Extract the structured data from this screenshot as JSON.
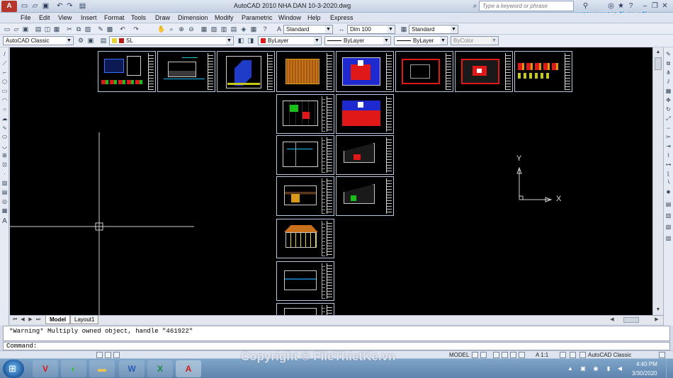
{
  "window": {
    "title": "AutoCAD 2010     NHA DAN 10-3-2020.dwg",
    "search_placeholder": "Type a keyword or phrase",
    "watermark_logo": "File Thiết Kế.vn"
  },
  "menu": [
    "File",
    "Edit",
    "View",
    "Insert",
    "Format",
    "Tools",
    "Draw",
    "Dimension",
    "Modify",
    "Parametric",
    "Window",
    "Help",
    "Express"
  ],
  "toolbar2": {
    "text_style": "Standard",
    "dim_style": "Dim 100",
    "table_style": "Standard"
  },
  "toolbar3": {
    "workspace": "AutoCAD Classic",
    "layer": "SL",
    "color": "ByLayer",
    "linetype": "ByLayer",
    "lineweight": "ByLayer",
    "plot_style": "ByColor"
  },
  "ucs": {
    "y": "Y",
    "x": "X"
  },
  "layout_tabs": [
    "Model",
    "Layout1"
  ],
  "command": {
    "history": "*Warning* Multiply owned object, handle \"461922\"",
    "prompt": "Command:"
  },
  "status": {
    "mode": "MODEL",
    "scale": "A 1:1",
    "workspace": "AutoCAD Classic"
  },
  "tray": {
    "time": "4:40 PM",
    "date": "3/30/2020"
  },
  "watermark_copyright": "Copyright © FileThietKe.vn",
  "colors": {
    "canvas": "#000000",
    "sheet_border": "#b5c8e0",
    "accent_red": "#e01818",
    "accent_orange": "#c8701a"
  }
}
